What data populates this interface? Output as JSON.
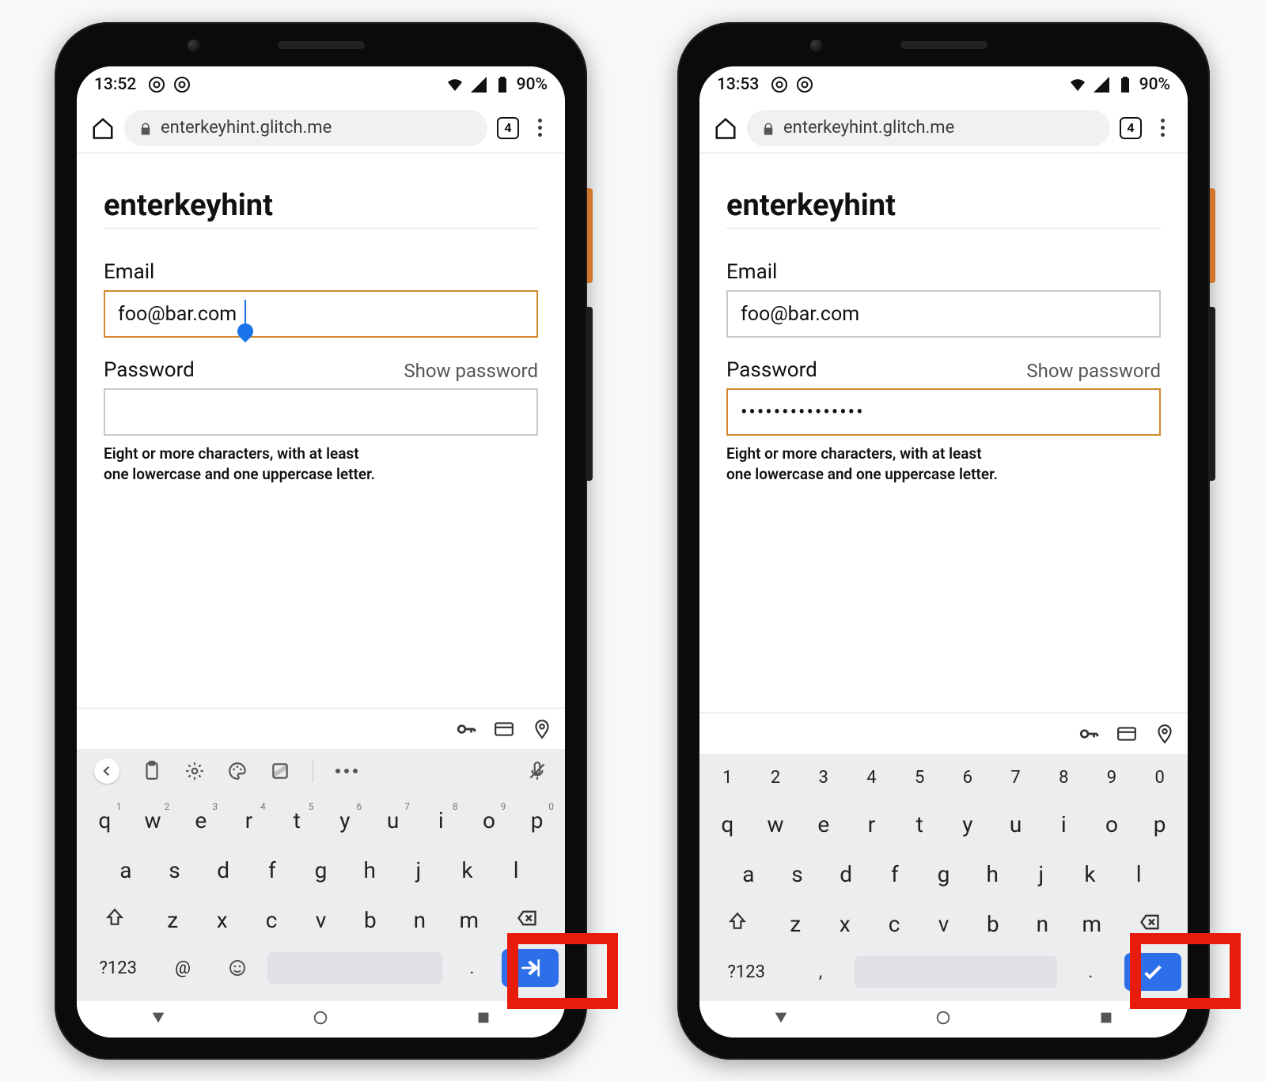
{
  "phones": {
    "left": {
      "status": {
        "time": "13:52",
        "battery": "90%"
      },
      "url": "enterkeyhint.glitch.me",
      "tab_count": "4",
      "page": {
        "title": "enterkeyhint",
        "email_label": "Email",
        "email_value": "foo@bar.com",
        "password_label": "Password",
        "show_password": "Show password",
        "password_value": "",
        "hint_line1": "Eight or more characters, with at least",
        "hint_line2": "one lowercase and one uppercase letter."
      },
      "keyboard": {
        "row4_sym": "?123",
        "row4_alt1": "@",
        "row4_dot": "."
      }
    },
    "right": {
      "status": {
        "time": "13:53",
        "battery": "90%"
      },
      "url": "enterkeyhint.glitch.me",
      "tab_count": "4",
      "page": {
        "title": "enterkeyhint",
        "email_label": "Email",
        "email_value": "foo@bar.com",
        "password_label": "Password",
        "show_password": "Show password",
        "password_value": "•••••••••••••••",
        "hint_line1": "Eight or more characters, with at least",
        "hint_line2": "one lowercase and one uppercase letter."
      },
      "keyboard": {
        "row4_sym": "?123",
        "row4_alt1": ",",
        "row4_dot": "."
      }
    }
  },
  "kbd_rows": {
    "nums": [
      "1",
      "2",
      "3",
      "4",
      "5",
      "6",
      "7",
      "8",
      "9",
      "0"
    ],
    "r1": [
      "q",
      "w",
      "e",
      "r",
      "t",
      "y",
      "u",
      "i",
      "o",
      "p"
    ],
    "r2": [
      "a",
      "s",
      "d",
      "f",
      "g",
      "h",
      "j",
      "k",
      "l"
    ],
    "r3": [
      "z",
      "x",
      "c",
      "v",
      "b",
      "n",
      "m"
    ]
  }
}
